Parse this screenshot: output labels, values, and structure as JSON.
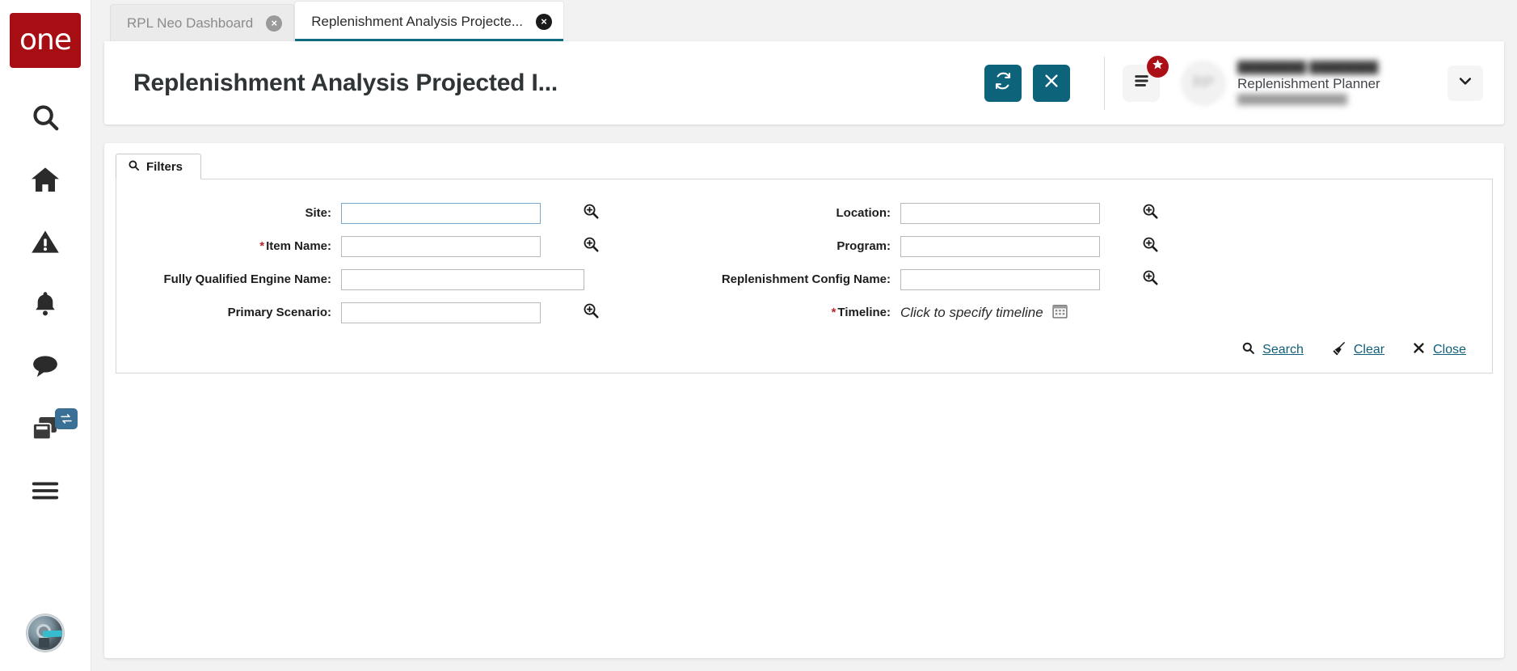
{
  "app": {
    "brand_text": "one",
    "brand_color": "#a70e13",
    "accent_color": "#0d6379",
    "link_color": "#0f5f78",
    "required_color": "#b3272d",
    "badge_color": "#aa1016",
    "rail_badge_color": "#3a6f96"
  },
  "rail": {
    "items": [
      {
        "name": "search-icon",
        "label": "Search"
      },
      {
        "name": "home-icon",
        "label": "Home"
      },
      {
        "name": "alerts-icon",
        "label": "Alerts"
      },
      {
        "name": "notifications-icon",
        "label": "Notifications"
      },
      {
        "name": "messages-icon",
        "label": "Messages"
      },
      {
        "name": "windows-icon",
        "label": "Windows"
      },
      {
        "name": "menu-icon",
        "label": "Menu"
      }
    ],
    "assistant_label": "Assistant"
  },
  "tabs": [
    {
      "label": "RPL Neo Dashboard",
      "active": false,
      "close_label": "×"
    },
    {
      "label": "Replenishment Analysis Projecte...",
      "active": true,
      "close_label": "×"
    }
  ],
  "header": {
    "title": "Replenishment Analysis Projected I...",
    "refresh_label": "Refresh",
    "close_label": "Close",
    "menu_label": "Menu",
    "badge_icon": "star-icon",
    "user": {
      "avatar_initials": "RP",
      "name": "████████ ████████",
      "role": "Replenishment Planner",
      "email": "████████████████",
      "caret_label": "▾"
    }
  },
  "filters": {
    "tab_label": "Filters",
    "fields": [
      {
        "id": "site",
        "label": "Site:",
        "required": false,
        "value": "",
        "placeholder": "",
        "lookup": true,
        "focused": true,
        "wide": false
      },
      {
        "id": "location",
        "label": "Location:",
        "required": false,
        "value": "",
        "placeholder": "",
        "lookup": true,
        "focused": false,
        "wide": false
      },
      {
        "id": "item_name",
        "label": "Item Name:",
        "required": true,
        "value": "",
        "placeholder": "",
        "lookup": true,
        "focused": false,
        "wide": false
      },
      {
        "id": "program",
        "label": "Program:",
        "required": false,
        "value": "",
        "placeholder": "",
        "lookup": true,
        "focused": false,
        "wide": false
      },
      {
        "id": "fully_qualified_engine_name",
        "label": "Fully Qualified Engine Name:",
        "required": false,
        "value": "",
        "placeholder": "",
        "lookup": false,
        "focused": false,
        "wide": true
      },
      {
        "id": "replenishment_config_name",
        "label": "Replenishment Config Name:",
        "required": false,
        "value": "",
        "placeholder": "",
        "lookup": true,
        "focused": false,
        "wide": false
      },
      {
        "id": "primary_scenario",
        "label": "Primary Scenario:",
        "required": false,
        "value": "",
        "placeholder": "",
        "lookup": true,
        "focused": false,
        "wide": false
      },
      {
        "id": "timeline",
        "label": "Timeline:",
        "required": true,
        "value": "Click to specify timeline",
        "placeholder": "Click to specify timeline",
        "lookup": false,
        "focused": false,
        "wide": false
      }
    ],
    "actions": [
      {
        "id": "search",
        "label": "Search",
        "icon": "search-icon"
      },
      {
        "id": "clear",
        "label": "Clear",
        "icon": "broom-icon"
      },
      {
        "id": "close",
        "label": "Close",
        "icon": "close-x-icon"
      }
    ]
  }
}
